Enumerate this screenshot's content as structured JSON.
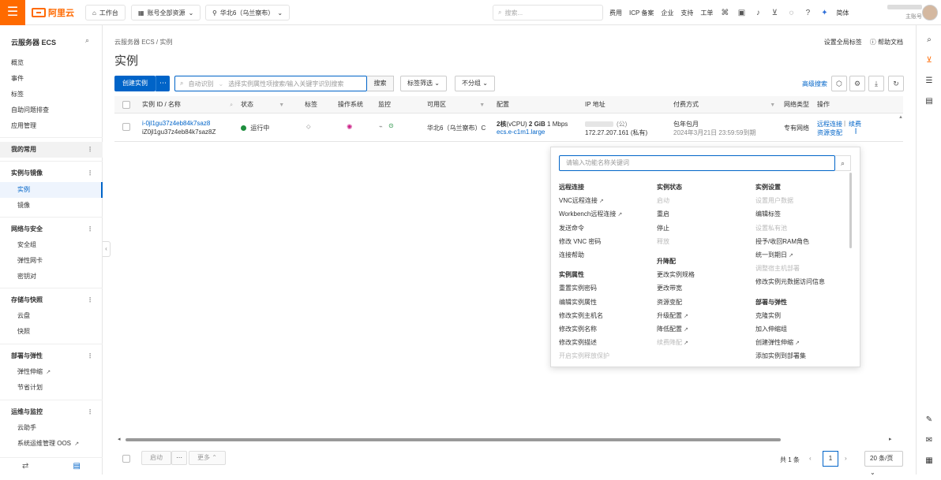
{
  "topbar": {
    "logo": "阿里云",
    "workbench": "工作台",
    "account_scope": "账号全部资源",
    "region": "华北6（乌兰察布）",
    "search_placeholder": "搜索...",
    "links": [
      "费用",
      "ICP 备案",
      "企业",
      "支持",
      "工单"
    ],
    "language": "简体",
    "account_type": "主账号"
  },
  "sidebar": {
    "title": "云服务器 ECS",
    "items": [
      {
        "label": "概览"
      },
      {
        "label": "事件"
      },
      {
        "label": "标签"
      },
      {
        "label": "自助问题排查"
      },
      {
        "label": "应用管理"
      },
      {
        "label": "我的常用"
      },
      {
        "label": "实例与镜像"
      },
      {
        "label": "实例"
      },
      {
        "label": "镜像"
      },
      {
        "label": "网络与安全"
      },
      {
        "label": "安全组"
      },
      {
        "label": "弹性网卡"
      },
      {
        "label": "密钥对"
      },
      {
        "label": "存储与快照"
      },
      {
        "label": "云盘"
      },
      {
        "label": "快照"
      },
      {
        "label": "部署与弹性"
      },
      {
        "label": "弹性伸缩"
      },
      {
        "label": "节省计划"
      },
      {
        "label": "运维与监控"
      },
      {
        "label": "云助手"
      },
      {
        "label": "系统运维管理 OOS"
      }
    ]
  },
  "main": {
    "breadcrumb": "云服务器 ECS  /  实例",
    "top_links": [
      "设置全局标签",
      "帮助文档"
    ],
    "title": "实例",
    "create_button": "创建实例",
    "filter_auto": "自动识别",
    "filter_placeholder": "选择实例属性项搜索/输入关键字识别搜索",
    "search_button": "搜索",
    "tag_filter": "标签筛选",
    "group": "不分组",
    "advanced_search": "高级搜索"
  },
  "table": {
    "headers": [
      "实例 ID / 名称",
      "状态",
      "标签",
      "操作系统",
      "监控",
      "可用区",
      "配置",
      "IP 地址",
      "付费方式",
      "网络类型",
      "操作"
    ],
    "rows": [
      {
        "id": "i-0jl1gu37z4eb84k7saz8",
        "name": "iZ0jl1gu37z4eb84k7saz8Z",
        "status": "运行中",
        "zone": "华北6（乌兰察布）C",
        "cpu": "2核",
        "cpu_unit": "(vCPU)",
        "mem": "2 GiB",
        "bandwidth": "1 Mbps",
        "spec": "ecs.e-c1m1.large",
        "public_ip_suffix": "(公)",
        "private_ip": "172.27.207.161 (私有)",
        "billing": "包年包月",
        "expire": "2024年3月21日 23:59:59到期",
        "network": "专有网络",
        "actions": [
          "远程连接",
          "续费"
        ],
        "action2": "资源变配"
      }
    ]
  },
  "popup": {
    "search_placeholder": "请输入功能名称关键词",
    "col1": [
      {
        "label": "远程连接",
        "type": "head"
      },
      {
        "label": "VNC远程连接",
        "ext": true
      },
      {
        "label": "Workbench远程连接",
        "ext": true
      },
      {
        "label": "发送命令"
      },
      {
        "label": "修改 VNC 密码"
      },
      {
        "label": "连接帮助"
      },
      {
        "label": "",
        "type": "gap"
      },
      {
        "label": "实例属性",
        "type": "head"
      },
      {
        "label": "重置实例密码"
      },
      {
        "label": "编辑实例属性"
      },
      {
        "label": "修改实例主机名"
      },
      {
        "label": "修改实例名称"
      },
      {
        "label": "修改实例描述"
      },
      {
        "label": "开启实例释放保护",
        "type": "dis"
      }
    ],
    "col2": [
      {
        "label": "实例状态",
        "type": "head"
      },
      {
        "label": "启动",
        "type": "dis"
      },
      {
        "label": "重启"
      },
      {
        "label": "停止"
      },
      {
        "label": "释放",
        "type": "dis"
      },
      {
        "label": "",
        "type": "gap"
      },
      {
        "label": "升降配",
        "type": "head"
      },
      {
        "label": "更改实例规格"
      },
      {
        "label": "更改带宽"
      },
      {
        "label": "资源变配"
      },
      {
        "label": "升级配置",
        "ext": true
      },
      {
        "label": "降低配置",
        "ext": true
      },
      {
        "label": "续费降配",
        "type": "dis",
        "ext": true
      }
    ],
    "col3": [
      {
        "label": "实例设置",
        "type": "head"
      },
      {
        "label": "设置用户数据",
        "type": "dis"
      },
      {
        "label": "编辑标签"
      },
      {
        "label": "设置私有池",
        "type": "dis"
      },
      {
        "label": "授予/收回RAM角色"
      },
      {
        "label": "统一到期日",
        "ext": true
      },
      {
        "label": "调整宿主机部署",
        "type": "dis"
      },
      {
        "label": "修改实例元数据访问信息"
      },
      {
        "label": "",
        "type": "gap"
      },
      {
        "label": "部署与弹性",
        "type": "head"
      },
      {
        "label": "克隆实例"
      },
      {
        "label": "加入伸缩组"
      },
      {
        "label": "创建弹性伸缩",
        "ext": true
      },
      {
        "label": "添加实例到部署集"
      }
    ]
  },
  "footer": {
    "start": "启动",
    "more": "更多",
    "total": "共 1 条",
    "page": "1",
    "page_size": "20 条/页"
  }
}
